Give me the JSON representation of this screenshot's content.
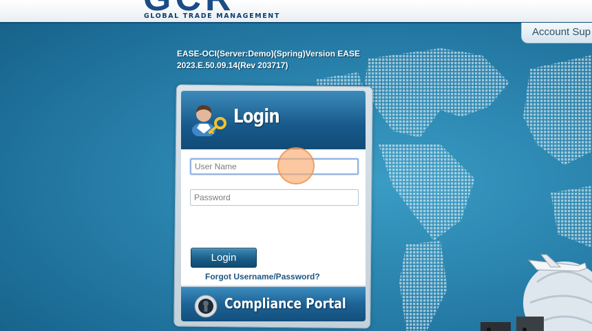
{
  "header": {
    "logo_text": "GCR",
    "logo_subtitle": "GLOBAL TRADE MANAGEMENT",
    "account_tab_label": "Account Sup"
  },
  "version": {
    "line1": "EASE-OCI(Server:Demo)(Spring)Version EASE",
    "line2": "2023.E.50.09.14(Rev 203717)"
  },
  "login": {
    "title": "Login",
    "username_placeholder": "User Name",
    "password_placeholder": "Password",
    "button_label": "Login",
    "forgot_link": "Forgot Username/Password?",
    "compliance_label": "Compliance Portal",
    "icon": "user-key-icon"
  },
  "colors": {
    "background": "#2a84ae",
    "header_blue": "#17598a",
    "link": "#1b5581",
    "cursor_highlight": "#f9aa6e"
  }
}
